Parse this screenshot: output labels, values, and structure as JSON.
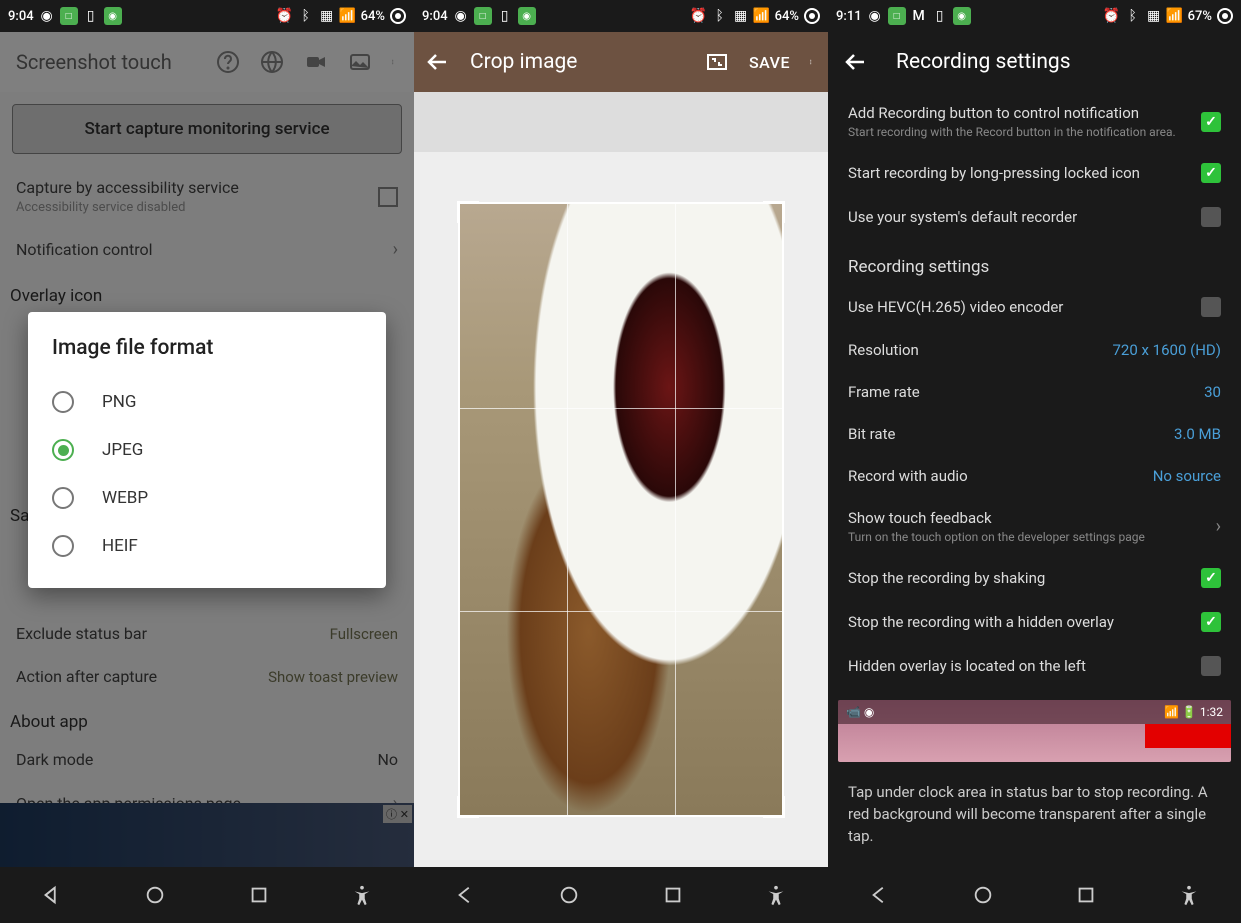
{
  "status": {
    "time1": "9:04",
    "time3": "9:11",
    "batt1": "64%",
    "batt3": "67%"
  },
  "p1": {
    "toolbar_title": "Screenshot touch",
    "big_button": "Start capture monitoring service",
    "accessibility": {
      "title": "Capture by accessibility service",
      "sub": "Accessibility service disabled"
    },
    "notification": "Notification control",
    "overlay_hdr": "Overlay icon",
    "save_hdr": "Sa",
    "exclude": {
      "title": "Exclude status bar",
      "val": "Fullscreen"
    },
    "action": {
      "title": "Action after capture",
      "val": "Show toast preview"
    },
    "about_hdr": "About app",
    "dark": {
      "title": "Dark mode",
      "val": "No"
    },
    "perm": "Open the app permissions page",
    "dialog": {
      "title": "Image file format",
      "opts": [
        "PNG",
        "JPEG",
        "WEBP",
        "HEIF"
      ],
      "selected": 1
    }
  },
  "p2": {
    "title": "Crop image",
    "save": "SAVE"
  },
  "p3": {
    "title": "Recording settings",
    "add_btn": {
      "title": "Add Recording button to control notification",
      "sub": "Start recording with the Record button in the notification area."
    },
    "longpress": "Start recording by long-pressing locked icon",
    "default_rec": "Use your system's default recorder",
    "rec_hdr": "Recording settings",
    "hevc": "Use HEVC(H.265) video encoder",
    "res": {
      "title": "Resolution",
      "val": "720 x 1600 (HD)"
    },
    "fps": {
      "title": "Frame rate",
      "val": "30"
    },
    "bitrate": {
      "title": "Bit rate",
      "val": "3.0 MB"
    },
    "audio": {
      "title": "Record with audio",
      "val": "No source"
    },
    "touch": {
      "title": "Show touch feedback",
      "sub": "Turn on the touch option on the developer settings page"
    },
    "shake": "Stop the recording by shaking",
    "overlay": "Stop the recording with a hidden overlay",
    "hidden_left": "Hidden overlay is located on the left",
    "pv_time": "1:32",
    "help": "Tap under clock area in status bar to stop recording. A red background will become transparent after a single tap."
  }
}
